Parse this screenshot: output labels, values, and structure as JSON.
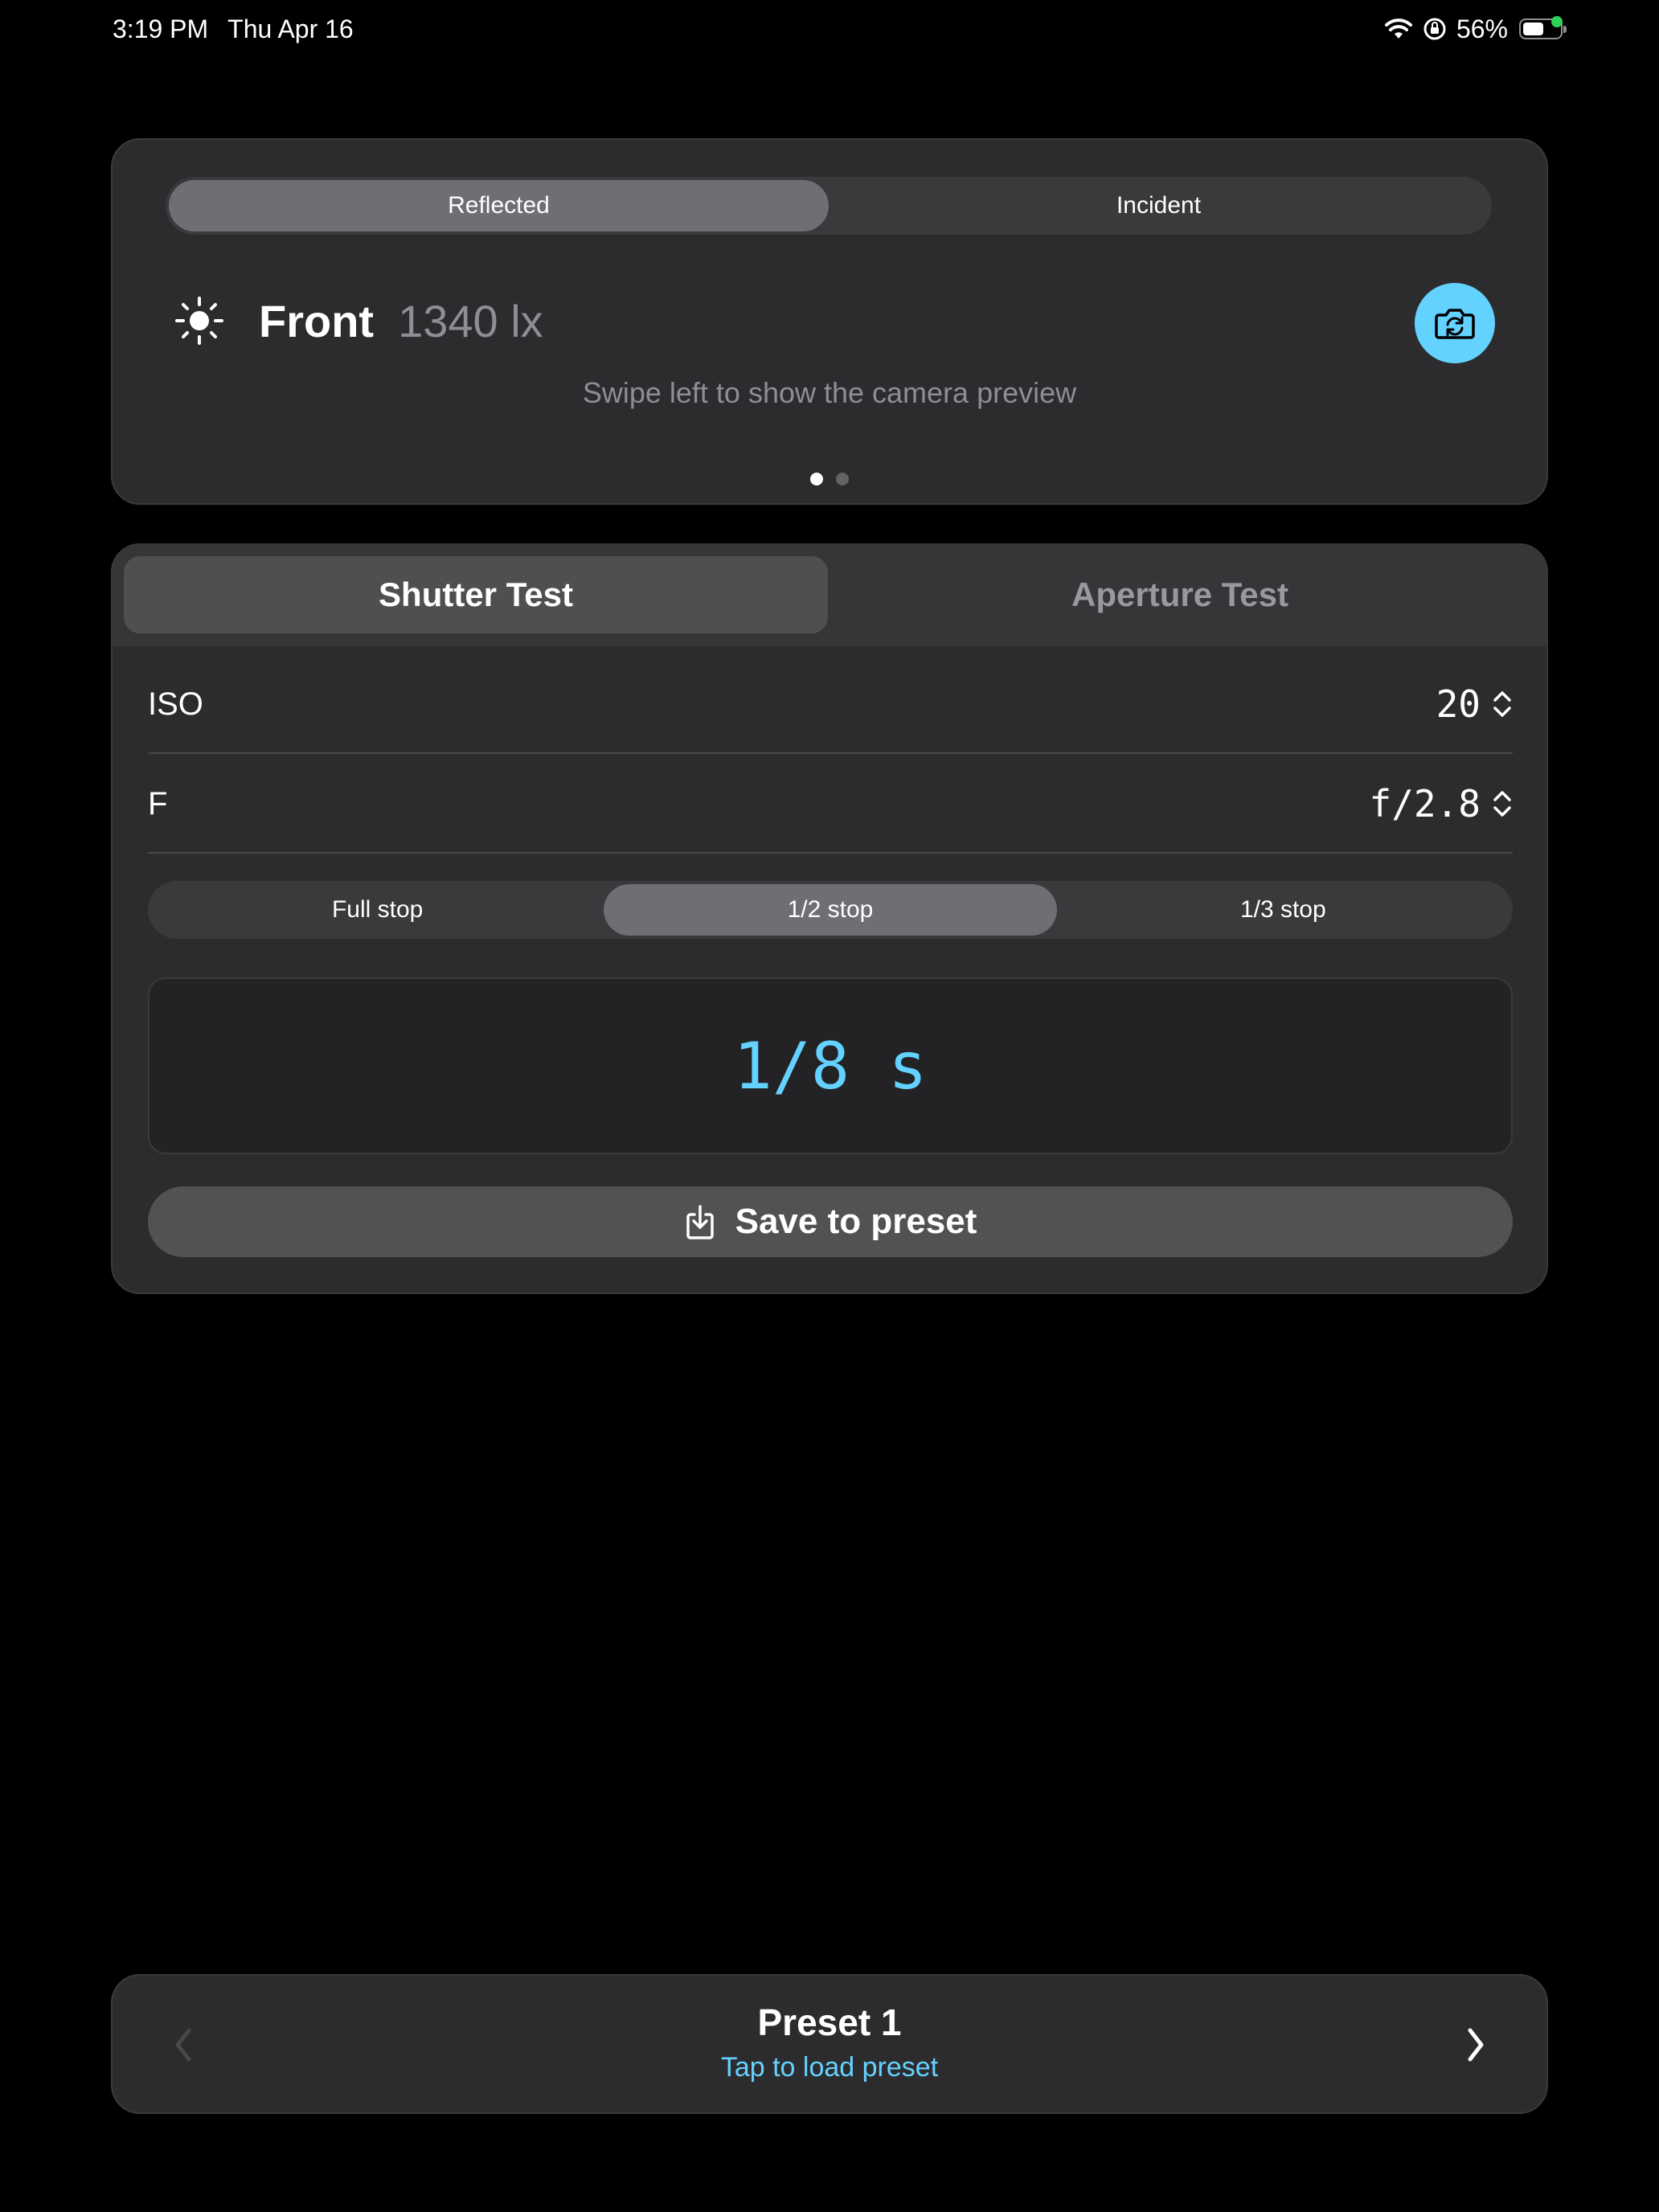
{
  "status_bar": {
    "time": "3:19 PM",
    "date": "Thu Apr 16",
    "battery_percent": "56%",
    "battery_level": 0.56,
    "icons": [
      "wifi-icon",
      "orientation-lock-icon",
      "battery-icon"
    ]
  },
  "light_meter": {
    "modes": [
      {
        "label": "Reflected",
        "selected": true
      },
      {
        "label": "Incident",
        "selected": false
      }
    ],
    "source_icon": "sun-icon",
    "source_label": "Front",
    "lux_value": "1340 lx",
    "camera_switch_icon": "camera-switch-icon",
    "hint": "Swipe left to show the camera preview",
    "page_count": 2,
    "current_page": 1
  },
  "test_panel": {
    "tabs": [
      {
        "label": "Shutter Test",
        "selected": true
      },
      {
        "label": "Aperture Test",
        "selected": false
      }
    ],
    "iso": {
      "label": "ISO",
      "value": "20"
    },
    "aperture": {
      "label": "F",
      "value": "f/2.8"
    },
    "stop_options": [
      {
        "label": "Full stop",
        "selected": false
      },
      {
        "label": "1/2 stop",
        "selected": true
      },
      {
        "label": "1/3 stop",
        "selected": false
      }
    ],
    "result": "1/8 s",
    "save_label": "Save to preset"
  },
  "preset": {
    "name": "Preset 1",
    "hint": "Tap to load preset",
    "prev_enabled": false,
    "next_enabled": true
  },
  "colors": {
    "background": "#000000",
    "card": "#2c2c2e",
    "accent": "#64d2ff",
    "status_green": "#30d158"
  }
}
